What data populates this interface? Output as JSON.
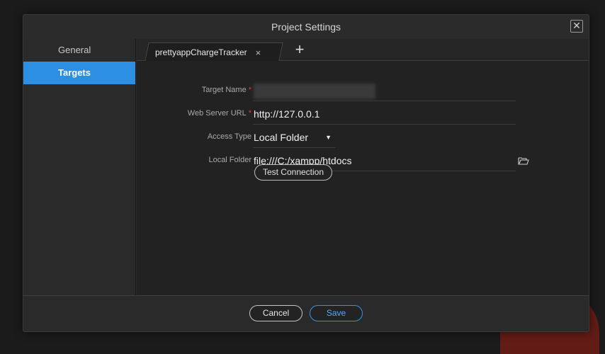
{
  "dialog": {
    "title": "Project Settings",
    "close_glyph": "✕"
  },
  "sidebar": {
    "items": [
      {
        "label": "General",
        "active": false
      },
      {
        "label": "Targets",
        "active": true
      }
    ]
  },
  "tabs": {
    "items": [
      {
        "label": "prettyappChargeTracker",
        "close_glyph": "×"
      }
    ],
    "add_glyph": "+"
  },
  "form": {
    "target_name": {
      "label": "Target Name",
      "required_mark": "*",
      "value_redacted": true
    },
    "web_server_url": {
      "label": "Web Server URL",
      "required_mark": "*",
      "value": "http://127.0.0.1"
    },
    "access_type": {
      "label": "Access Type",
      "value": "Local Folder",
      "arrow": "▼"
    },
    "local_folder": {
      "label": "Local Folder",
      "value": "file:///C:/xampp/htdocs",
      "icon": "folder-open-icon"
    },
    "test_connection_label": "Test Connection"
  },
  "footer": {
    "cancel_label": "Cancel",
    "save_label": "Save"
  },
  "colors": {
    "accent": "#2d8fe3",
    "required": "#e03c3c",
    "save_text": "#5aa8f0"
  }
}
